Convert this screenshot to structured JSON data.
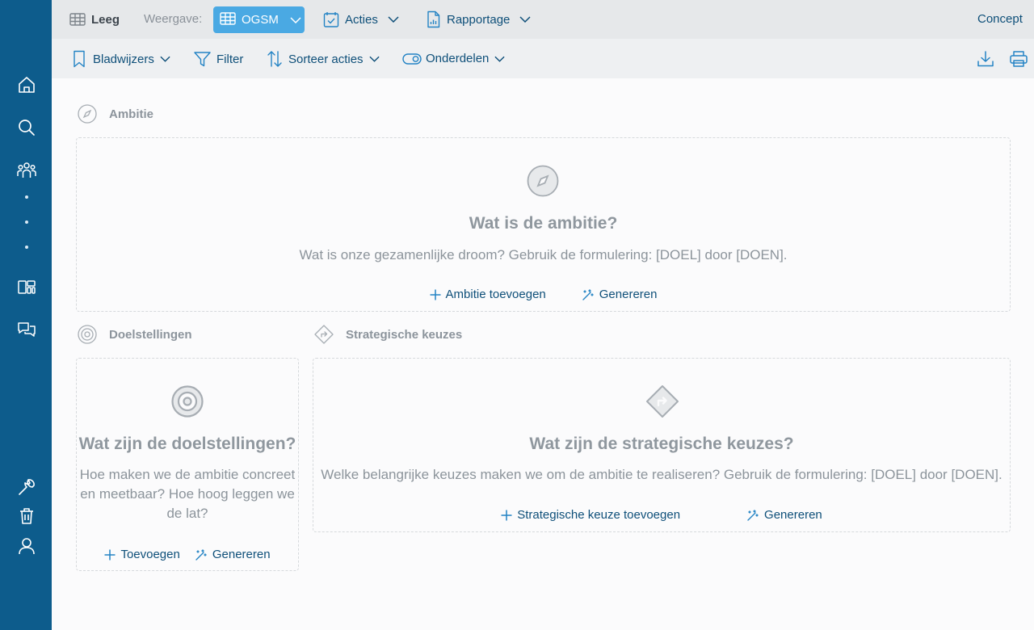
{
  "topbar": {
    "leeg": "Leeg",
    "weergave_label": "Weergave:",
    "view_value": "OGSM",
    "acties": "Acties",
    "rapportage": "Rapportage",
    "concept": "Concept"
  },
  "subbar": {
    "bladwijzers": "Bladwijzers",
    "filter": "Filter",
    "sorteer": "Sorteer acties",
    "onderdelen": "Onderdelen"
  },
  "ambitie": {
    "heading": "Ambitie",
    "title": "Wat is de ambitie?",
    "text": "Wat is onze gezamenlijke droom? Gebruik de formulering: [DOEL] door [DOEN].",
    "add": "Ambitie toevoegen",
    "generate": "Genereren"
  },
  "doelstellingen": {
    "heading": "Doelstellingen",
    "title": "Wat zijn de doelstellingen?",
    "text": "Hoe maken we de ambitie concreet en meetbaar? Hoe hoog leggen we de lat?",
    "add": "Toevoegen",
    "generate": "Genereren"
  },
  "strategische": {
    "heading": "Strategische keuzes",
    "title": "Wat zijn de strategische keuzes?",
    "text": "Welke belangrijke keuzes maken we om de ambitie te realiseren? Gebruik de formulering: [DOEL] door [DOEN].",
    "add": "Strategische keuze toevoegen",
    "generate": "Genereren"
  },
  "colors": {
    "sidebar": "#0d5c8c",
    "accent": "#4aa9e3",
    "link": "#0e4f79"
  }
}
